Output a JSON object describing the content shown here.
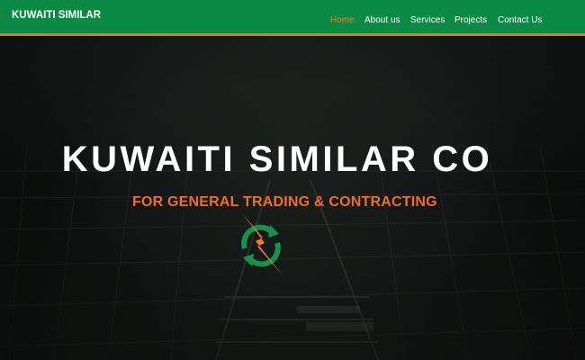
{
  "brand": {
    "name": "KUWAITI SIMILAR"
  },
  "nav": {
    "items": [
      {
        "label": "Home",
        "active": true
      },
      {
        "label": "About us",
        "active": false
      },
      {
        "label": "Services",
        "active": false
      },
      {
        "label": "Projects",
        "active": false
      },
      {
        "label": "Contact Us",
        "active": false
      }
    ]
  },
  "hero": {
    "title": "KUWAITI SIMILAR CO",
    "subtitle": "FOR GENERAL TRADING & CONTRACTING",
    "logo_icon": "green-cycle-lightning-icon"
  },
  "colors": {
    "nav_background": "#0a8a44",
    "nav_underline": "#e0782a",
    "active_link": "#f07a2a",
    "subtitle": "#ef6f2a",
    "logo_green": "#17924a",
    "logo_orange": "#ef7b2c"
  }
}
